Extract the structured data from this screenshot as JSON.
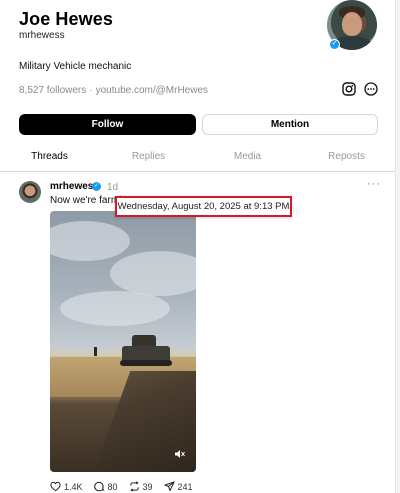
{
  "profile": {
    "name": "Joe Hewes",
    "handle": "mrhewess",
    "bio": "Military Vehicle mechanic",
    "followers": "8,527 followers",
    "separator": "·",
    "link": "youtube.com/@MrHewes",
    "verified_badge": "✓"
  },
  "buttons": {
    "follow": "Follow",
    "mention": "Mention"
  },
  "tabs": [
    "Threads",
    "Replies",
    "Media",
    "Reposts"
  ],
  "post": {
    "user": "mrhewess",
    "verified_badge": "✓",
    "time": "1d",
    "more": "···",
    "text": "Now we're farmi",
    "tooltip": "Wednesday, August 20, 2025 at 9:13 PM",
    "actions": {
      "likes": "1.4K",
      "comments": "80",
      "reposts": "39",
      "shares": "241"
    }
  },
  "icons": {
    "instagram": "instagram-icon",
    "more": "more-circle-icon",
    "mute": "mute-icon",
    "like": "heart-icon",
    "comment": "comment-icon",
    "repost": "repost-icon",
    "share": "share-icon"
  },
  "colors": {
    "accent": "#1d9bf0",
    "follow_bg": "#000000",
    "tooltip_border": "#d11a2a"
  }
}
